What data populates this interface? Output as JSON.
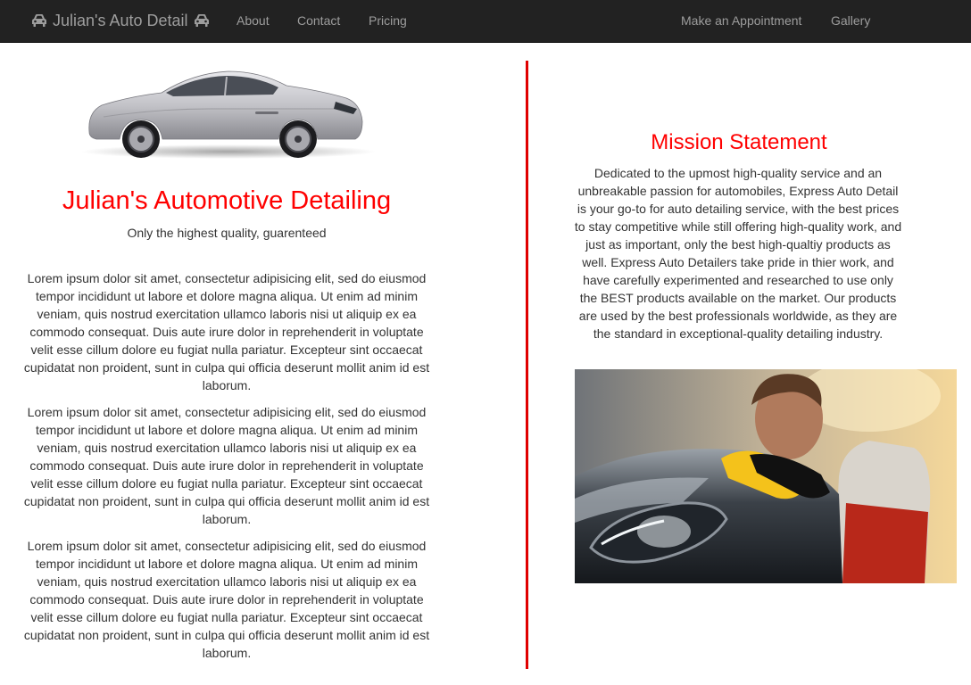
{
  "navbar": {
    "brand": "Julian's Auto Detail",
    "links_left": [
      "About",
      "Contact",
      "Pricing"
    ],
    "links_right": [
      "Make an Appointment",
      "Gallery"
    ]
  },
  "hero": {
    "title": "Julian's Automotive Detailing",
    "tagline": "Only the highest quality, guarenteed"
  },
  "paragraphs": [
    "Lorem ipsum dolor sit amet, consectetur adipisicing elit, sed do eiusmod tempor incididunt ut labore et dolore magna aliqua. Ut enim ad minim veniam, quis nostrud exercitation ullamco laboris nisi ut aliquip ex ea commodo consequat. Duis aute irure dolor in reprehenderit in voluptate velit esse cillum dolore eu fugiat nulla pariatur. Excepteur sint occaecat cupidatat non proident, sunt in culpa qui officia deserunt mollit anim id est laborum.",
    "Lorem ipsum dolor sit amet, consectetur adipisicing elit, sed do eiusmod tempor incididunt ut labore et dolore magna aliqua. Ut enim ad minim veniam, quis nostrud exercitation ullamco laboris nisi ut aliquip ex ea commodo consequat. Duis aute irure dolor in reprehenderit in voluptate velit esse cillum dolore eu fugiat nulla pariatur. Excepteur sint occaecat cupidatat non proident, sunt in culpa qui officia deserunt mollit anim id est laborum.",
    "Lorem ipsum dolor sit amet, consectetur adipisicing elit, sed do eiusmod tempor incididunt ut labore et dolore magna aliqua. Ut enim ad minim veniam, quis nostrud exercitation ullamco laboris nisi ut aliquip ex ea commodo consequat. Duis aute irure dolor in reprehenderit in voluptate velit esse cillum dolore eu fugiat nulla pariatur. Excepteur sint occaecat cupidatat non proident, sunt in culpa qui officia deserunt mollit anim id est laborum."
  ],
  "mission": {
    "title": "Mission Statement",
    "text": "Dedicated to the upmost high-quality service and an unbreakable passion for automobiles, Express Auto Detail is your go-to for auto detailing service, with the best prices to stay competitive while still offering high-quality work, and just as important, only the best high-qualtiy products as well. Express Auto Detailers take pride in thier work, and have carefully experimented and researched to use only the BEST products available on the market. Our products are used by the best professionals worldwide, as they are the standard in exceptional-quality detailing industry."
  },
  "colors": {
    "accent": "#ff0000",
    "navbar_bg": "#222222",
    "nav_text": "#9d9d9d",
    "divider": "#e00000"
  },
  "icons": [
    "car-icon",
    "car-icon"
  ]
}
